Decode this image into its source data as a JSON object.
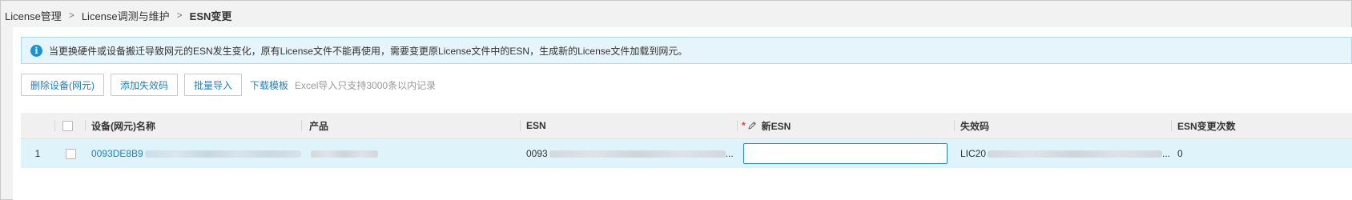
{
  "breadcrumb": {
    "items": [
      "License管理",
      "License调测与维护"
    ],
    "current": "ESN变更",
    "separator": ">"
  },
  "info": {
    "icon": "info-icon",
    "icon_glyph": "i",
    "text": "当更换硬件或设备搬迁导致网元的ESN发生变化，原有License文件不能再使用，需要变更原License文件中的ESN，生成新的License文件加载到网元。"
  },
  "toolbar": {
    "delete_device": "删除设备(网元)",
    "add_invalid_code": "添加失效码",
    "batch_import": "批量导入",
    "download_template": "下载模板",
    "hint": "Excel导入只支持3000条以内记录"
  },
  "table": {
    "columns": {
      "device_name": "设备(网元)名称",
      "product": "产品",
      "esn": "ESN",
      "new_esn": "新ESN",
      "invalid_code": "失效码",
      "esn_change_count": "ESN变更次数"
    },
    "required_mark": "*",
    "rows": [
      {
        "index": "1",
        "device_name": "0093DE8B9",
        "product": "",
        "esn": "0093",
        "esn_suffix": "...",
        "new_esn_value": "",
        "invalid_code": "LIC20",
        "invalid_code_suffix": "...",
        "esn_change_count": "0"
      }
    ]
  },
  "colors": {
    "accent": "#1a80c8",
    "info_bg": "#e6f5fb",
    "row_selected_bg": "#dff3fb",
    "header_bg": "#f0f0f0"
  }
}
